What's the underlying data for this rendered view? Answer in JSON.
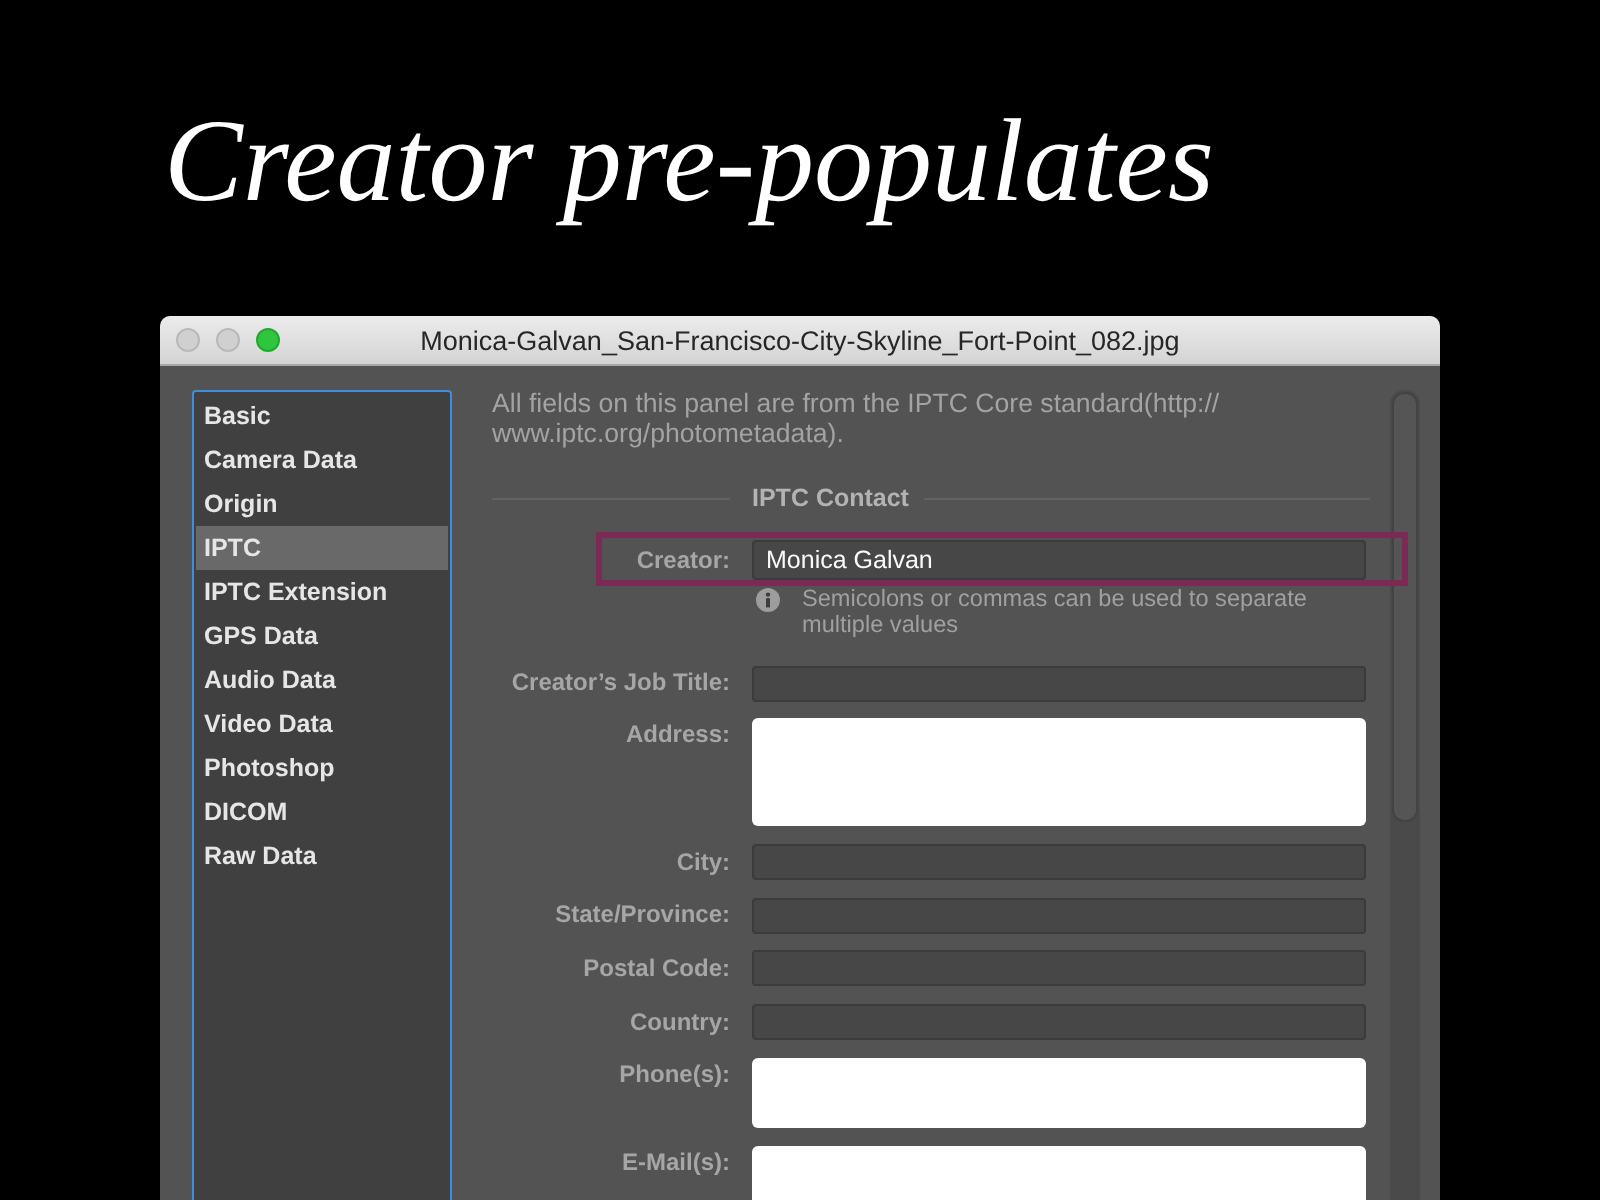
{
  "slide_title": "Creator pre-populates",
  "window": {
    "title": "Monica-Galvan_San-Francisco-City-Skyline_Fort-Point_082.jpg"
  },
  "sidebar": {
    "items": [
      {
        "label": "Basic",
        "selected": false
      },
      {
        "label": "Camera Data",
        "selected": false
      },
      {
        "label": "Origin",
        "selected": false
      },
      {
        "label": "IPTC",
        "selected": true
      },
      {
        "label": "IPTC Extension",
        "selected": false
      },
      {
        "label": "GPS Data",
        "selected": false
      },
      {
        "label": "Audio Data",
        "selected": false
      },
      {
        "label": "Video Data",
        "selected": false
      },
      {
        "label": "Photoshop",
        "selected": false
      },
      {
        "label": "DICOM",
        "selected": false
      },
      {
        "label": "Raw Data",
        "selected": false
      }
    ]
  },
  "panel": {
    "intro_lines": [
      "All fields on this panel are from the IPTC Core standard(http://",
      "www.iptc.org/photometadata)."
    ],
    "section_title": "IPTC Contact",
    "fields": [
      {
        "label": "Creator:",
        "kind": "line",
        "value": "Monica Galvan",
        "highlighted": true,
        "hint": "Semicolons or commas can be used to separate multiple values"
      },
      {
        "label": "Creator’s Job Title:",
        "kind": "line",
        "highlighted": false
      },
      {
        "label": "Address:",
        "kind": "large_area",
        "highlighted": false
      },
      {
        "label": "City:",
        "kind": "line",
        "highlighted": false
      },
      {
        "label": "State/Province:",
        "kind": "line",
        "highlighted": false
      },
      {
        "label": "Postal Code:",
        "kind": "line",
        "highlighted": false
      },
      {
        "label": "Country:",
        "kind": "line",
        "highlighted": false
      },
      {
        "label": "Phone(s):",
        "kind": "area",
        "highlighted": false
      },
      {
        "label": "E-Mail(s):",
        "kind": "area",
        "highlighted": false
      }
    ]
  }
}
